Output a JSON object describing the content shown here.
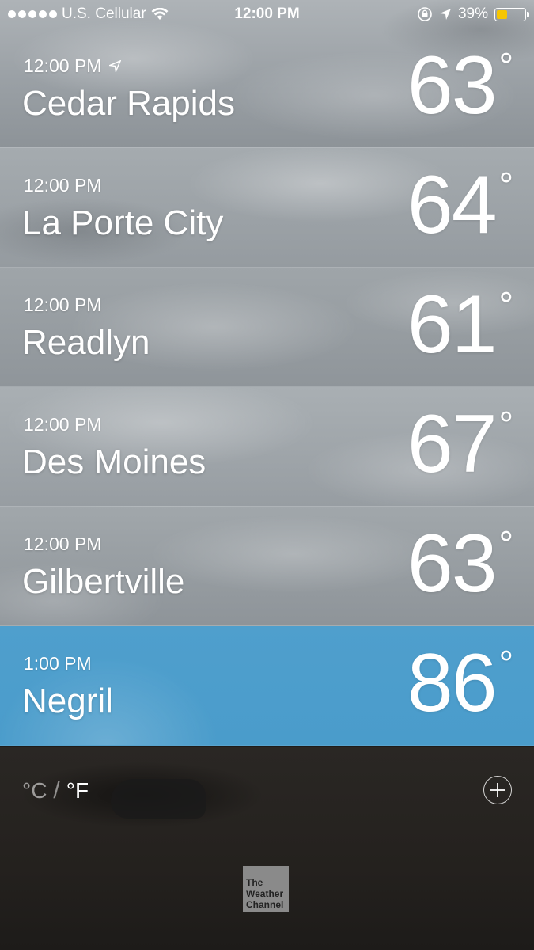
{
  "status_bar": {
    "carrier": "U.S. Cellular",
    "time": "12:00 PM",
    "battery": "39%",
    "battery_level": 0.39,
    "icons": [
      "signal-dots-icon",
      "wifi-icon",
      "rotation-lock-icon",
      "location-arrow-icon",
      "battery-icon"
    ]
  },
  "cities": [
    {
      "time": "12:00 PM",
      "name": "Cedar Rapids",
      "temp": "63",
      "current_location": true
    },
    {
      "time": "12:00 PM",
      "name": "La Porte City",
      "temp": "64"
    },
    {
      "time": "12:00 PM",
      "name": "Readlyn",
      "temp": "61"
    },
    {
      "time": "12:00 PM",
      "name": "Des Moines",
      "temp": "67"
    },
    {
      "time": "12:00 PM",
      "name": "Gilbertville",
      "temp": "63"
    },
    {
      "time": "1:00 PM",
      "name": "Negril",
      "temp": "86",
      "active": true
    }
  ],
  "degree_symbol": "°",
  "units": {
    "celsius": "°C",
    "separator": "/",
    "fahrenheit": "°F",
    "selected": "fahrenheit"
  },
  "logo": {
    "line1": "The",
    "line2": "Weather",
    "line3": "Channel"
  },
  "colors": {
    "active_row": "#4a9ccb",
    "battery": "#f7c600"
  }
}
